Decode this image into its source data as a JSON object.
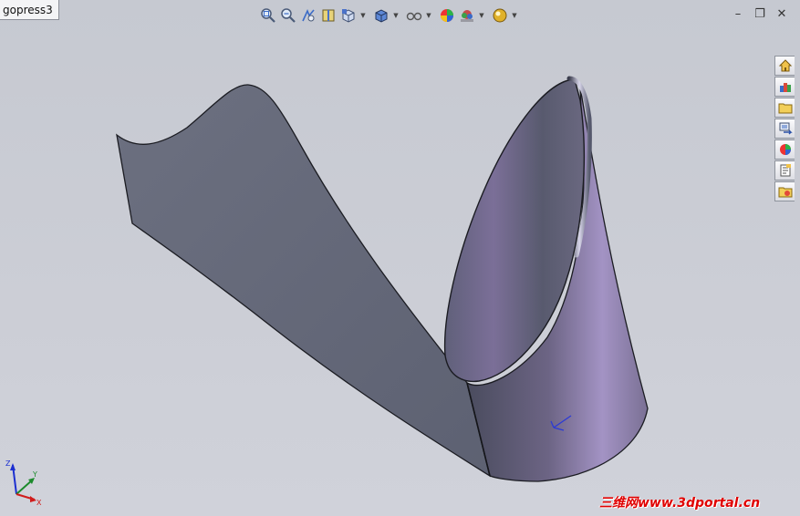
{
  "document": {
    "tab_title": "gopress3"
  },
  "toolbar": {
    "icons": [
      "zoom-to-fit-icon",
      "zoom-to-area-icon",
      "previous-view-icon",
      "section-view-icon",
      "view-orientation-icon",
      "display-style-icon",
      "hide-show-items-icon",
      "edit-appearance-icon",
      "apply-scene-icon",
      "view-settings-icon"
    ]
  },
  "window_controls": {
    "minimize": "–",
    "restore": "❐",
    "close": "✕"
  },
  "taskpane": {
    "icons": [
      "solidworks-resources-icon",
      "design-library-icon",
      "file-explorer-icon",
      "view-palette-icon",
      "appearances-scenes-icon",
      "custom-properties-icon",
      "recent-documents-icon"
    ]
  },
  "triad": {
    "x": "X",
    "y": "Y",
    "z": "Z"
  },
  "watermark": "三维网www.3dportal.cn"
}
